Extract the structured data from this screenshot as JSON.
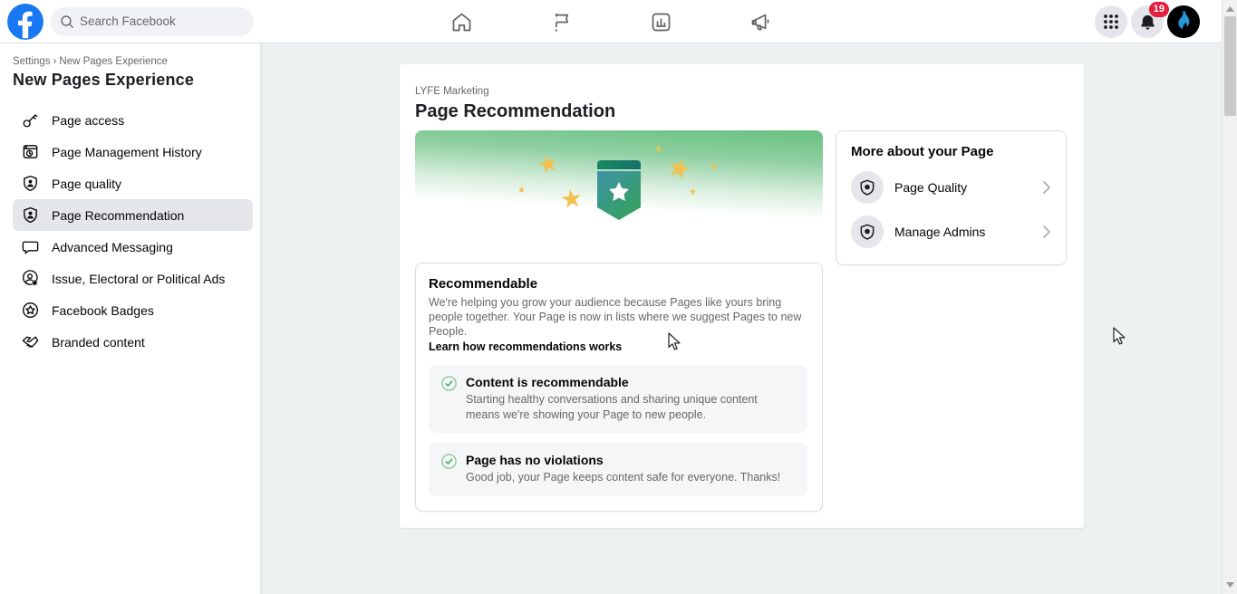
{
  "navbar": {
    "search": {
      "placeholder": "Search Facebook",
      "icon": "search-icon"
    },
    "tabs": [
      {
        "name": "home",
        "icon": "home-icon"
      },
      {
        "name": "pages",
        "icon": "flag-icon"
      },
      {
        "name": "insights",
        "icon": "insights-chart-icon"
      },
      {
        "name": "ads",
        "icon": "megaphone-icon"
      }
    ],
    "apps_menu_icon": "app-grid-icon",
    "notifications": {
      "icon": "bell-icon",
      "badge_count": "19"
    },
    "profile_logo": "lyfe-flame-logo"
  },
  "sidebar": {
    "breadcrumb": {
      "root": "Settings",
      "separator": "›",
      "current": "New Pages Experience"
    },
    "title": "New Pages Experience",
    "items": [
      {
        "label": "Page access",
        "icon": "key-icon",
        "selected": false
      },
      {
        "label": "Page Management History",
        "icon": "history-window-icon",
        "selected": false
      },
      {
        "label": "Page quality",
        "icon": "shield-person-icon",
        "selected": false
      },
      {
        "label": "Page Recommendation",
        "icon": "shield-person-icon",
        "selected": true
      },
      {
        "label": "Advanced Messaging",
        "icon": "chat-bubble-icon",
        "selected": false
      },
      {
        "label": "Issue, Electoral or Political Ads",
        "icon": "person-gear-icon",
        "selected": false
      },
      {
        "label": "Facebook Badges",
        "icon": "badge-star-icon",
        "selected": false
      },
      {
        "label": "Branded content",
        "icon": "handshake-icon",
        "selected": false
      }
    ]
  },
  "main": {
    "page_owner": "LYFE Marketing",
    "title": "Page Recommendation",
    "banner_icon": "award-ribbon-star-badge",
    "recommendable": {
      "title": "Recommendable",
      "description": "We're helping you grow your audience because Pages like yours bring people together. Your Page is now in lists where we suggest Pages to new People.",
      "link_label": "Learn how recommendations works",
      "checks": [
        {
          "title": "Content is recommendable",
          "description": "Starting healthy conversations and sharing unique content means we're showing your Page to new people.",
          "icon": "check-circle-icon"
        },
        {
          "title": "Page has no violations",
          "description": "Good job, your Page keeps content safe for everyone. Thanks!",
          "icon": "check-circle-icon"
        }
      ]
    },
    "more_about": {
      "title": "More about your Page",
      "items": [
        {
          "label": "Page Quality",
          "icon": "shield-icon"
        },
        {
          "label": "Manage Admins",
          "icon": "shield-icon"
        }
      ]
    }
  },
  "colors": {
    "background": "#eef1f2",
    "accent_green": "#31a24c",
    "banner_green": "#68c180",
    "star_gold": "#f2c14e",
    "badge_red": "#e41e3f",
    "selected_item_bg": "#e4e6e9"
  }
}
